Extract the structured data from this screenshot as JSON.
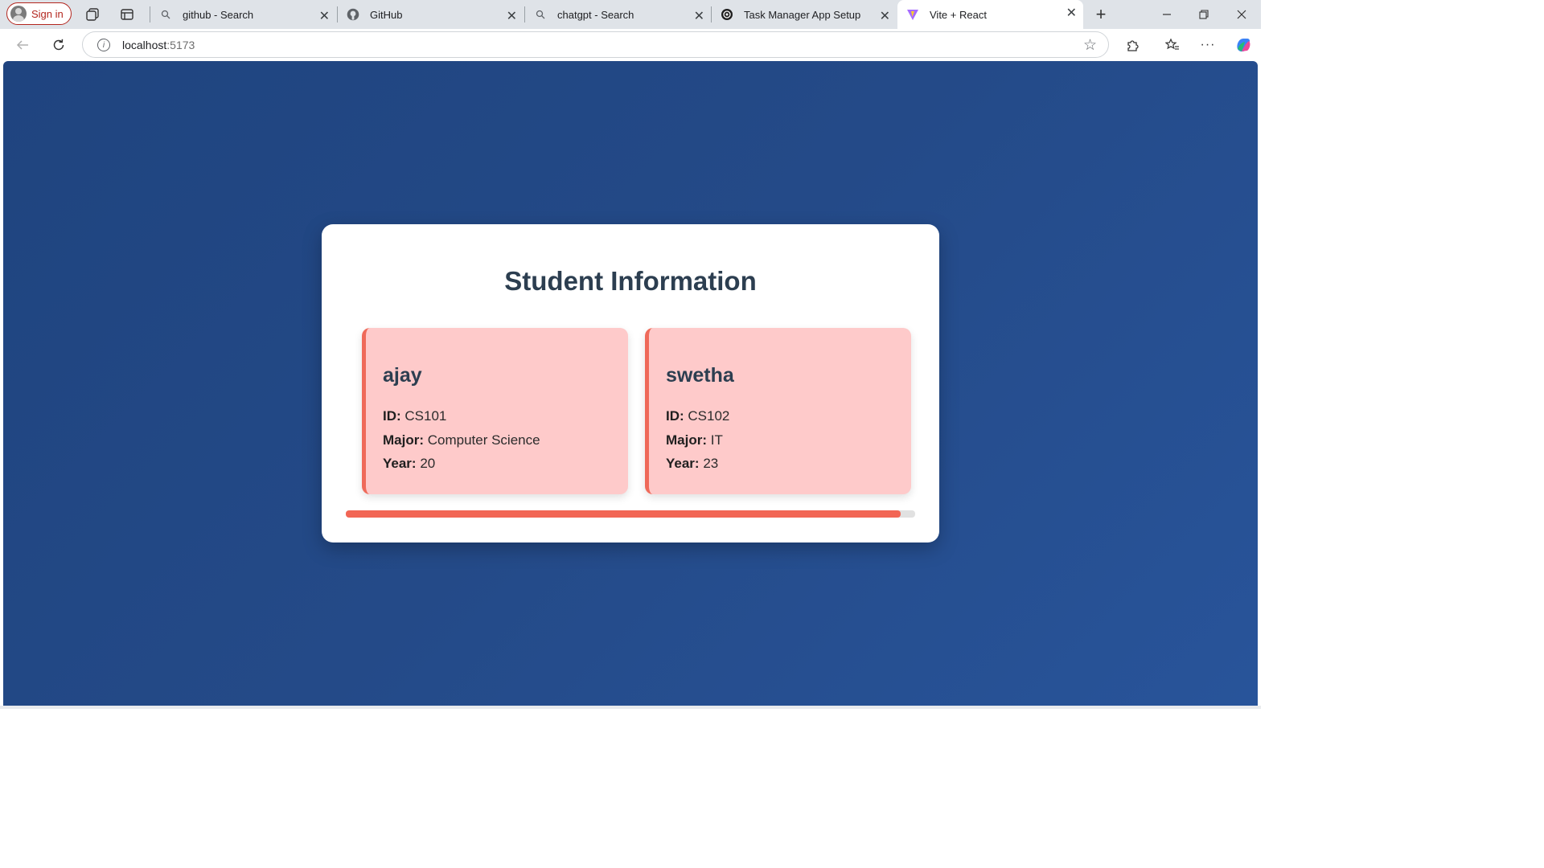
{
  "browser": {
    "signin_label": "Sign in",
    "tabs": [
      {
        "title": "github - Search",
        "icon": "search-icon"
      },
      {
        "title": "GitHub",
        "icon": "github-icon"
      },
      {
        "title": "chatgpt - Search",
        "icon": "search-icon"
      },
      {
        "title": "Task Manager App Setup",
        "icon": "chatgpt-icon"
      },
      {
        "title": "Vite + React",
        "icon": "vite-icon",
        "active": true
      }
    ],
    "url_host": "localhost",
    "url_port": ":5173"
  },
  "page": {
    "title": "Student Information",
    "labels": {
      "id": "ID:",
      "major": "Major:",
      "year": "Year:"
    },
    "students": [
      {
        "name": "ajay",
        "id": "CS101",
        "major": "Computer Science",
        "year": "20"
      },
      {
        "name": "swetha",
        "id": "CS102",
        "major": "IT",
        "year": "23"
      }
    ],
    "scroll_fraction": 0.975
  },
  "colors": {
    "background": "#244a88",
    "card": "#ffffff",
    "student_card": "#fecaca",
    "accent": "#ef6a5a",
    "title_text": "#2c3e50"
  }
}
